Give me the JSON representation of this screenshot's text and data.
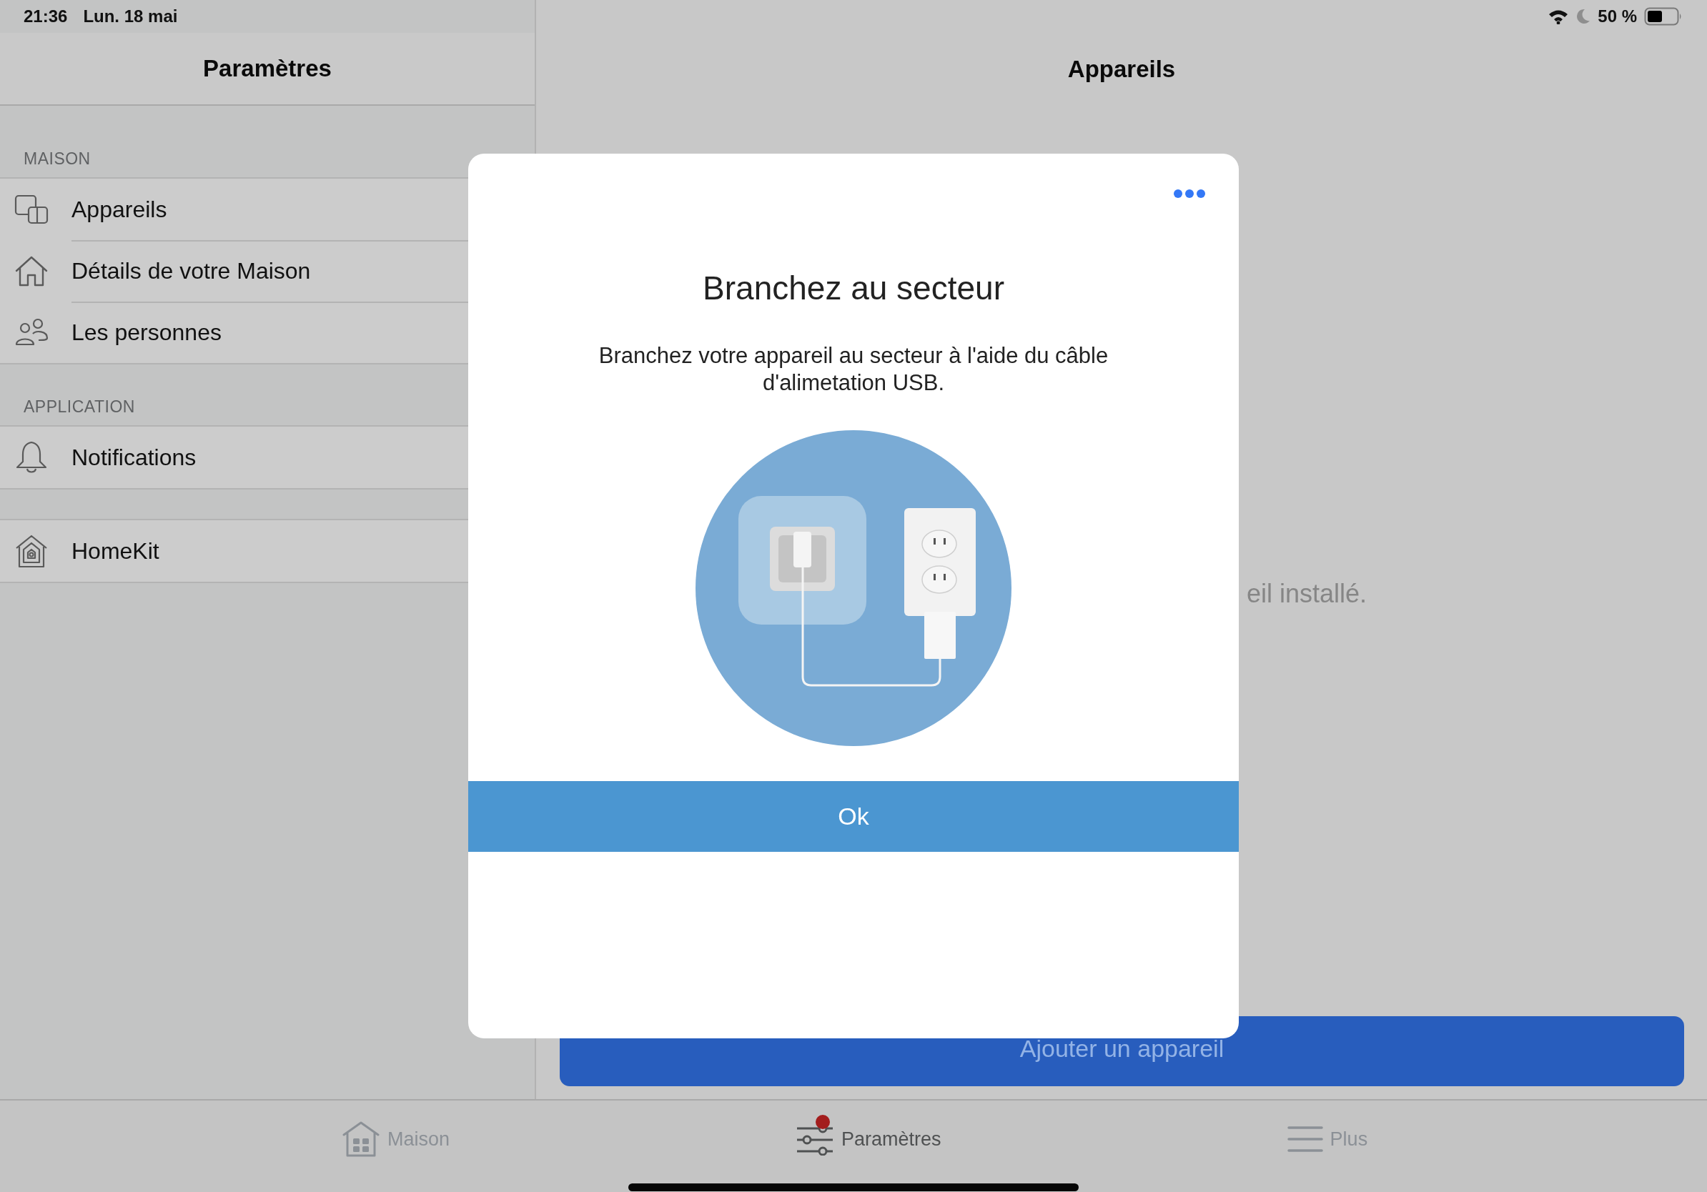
{
  "status_bar": {
    "time": "21:36",
    "date": "Lun. 18 mai",
    "battery": "50 %"
  },
  "sidebar": {
    "title": "Paramètres",
    "sections": [
      {
        "header": "MAISON",
        "items": [
          {
            "label": "Appareils",
            "kind": "devices"
          },
          {
            "label": "Détails de votre Maison",
            "kind": "house"
          },
          {
            "label": "Les personnes",
            "kind": "people"
          }
        ]
      },
      {
        "header": "APPLICATION",
        "items": [
          {
            "label": "Notifications",
            "kind": "bell"
          }
        ]
      },
      {
        "items": [
          {
            "label": "HomeKit",
            "kind": "homekit"
          }
        ]
      }
    ]
  },
  "detail": {
    "title": "Appareils",
    "message": "eil installé.",
    "add_button": "Ajouter un appareil"
  },
  "dialog": {
    "title": "Branchez au secteur",
    "message": "Branchez votre appareil au secteur à l'aide du câble d'alimetation USB.",
    "ok_button": "Ok"
  },
  "tab_bar": [
    {
      "label": "Maison",
      "kind": "home",
      "selected": false,
      "badge": false
    },
    {
      "label": "Paramètres",
      "kind": "sliders",
      "selected": true,
      "badge": true
    },
    {
      "label": "Plus",
      "kind": "menu",
      "selected": false,
      "badge": false
    }
  ]
}
